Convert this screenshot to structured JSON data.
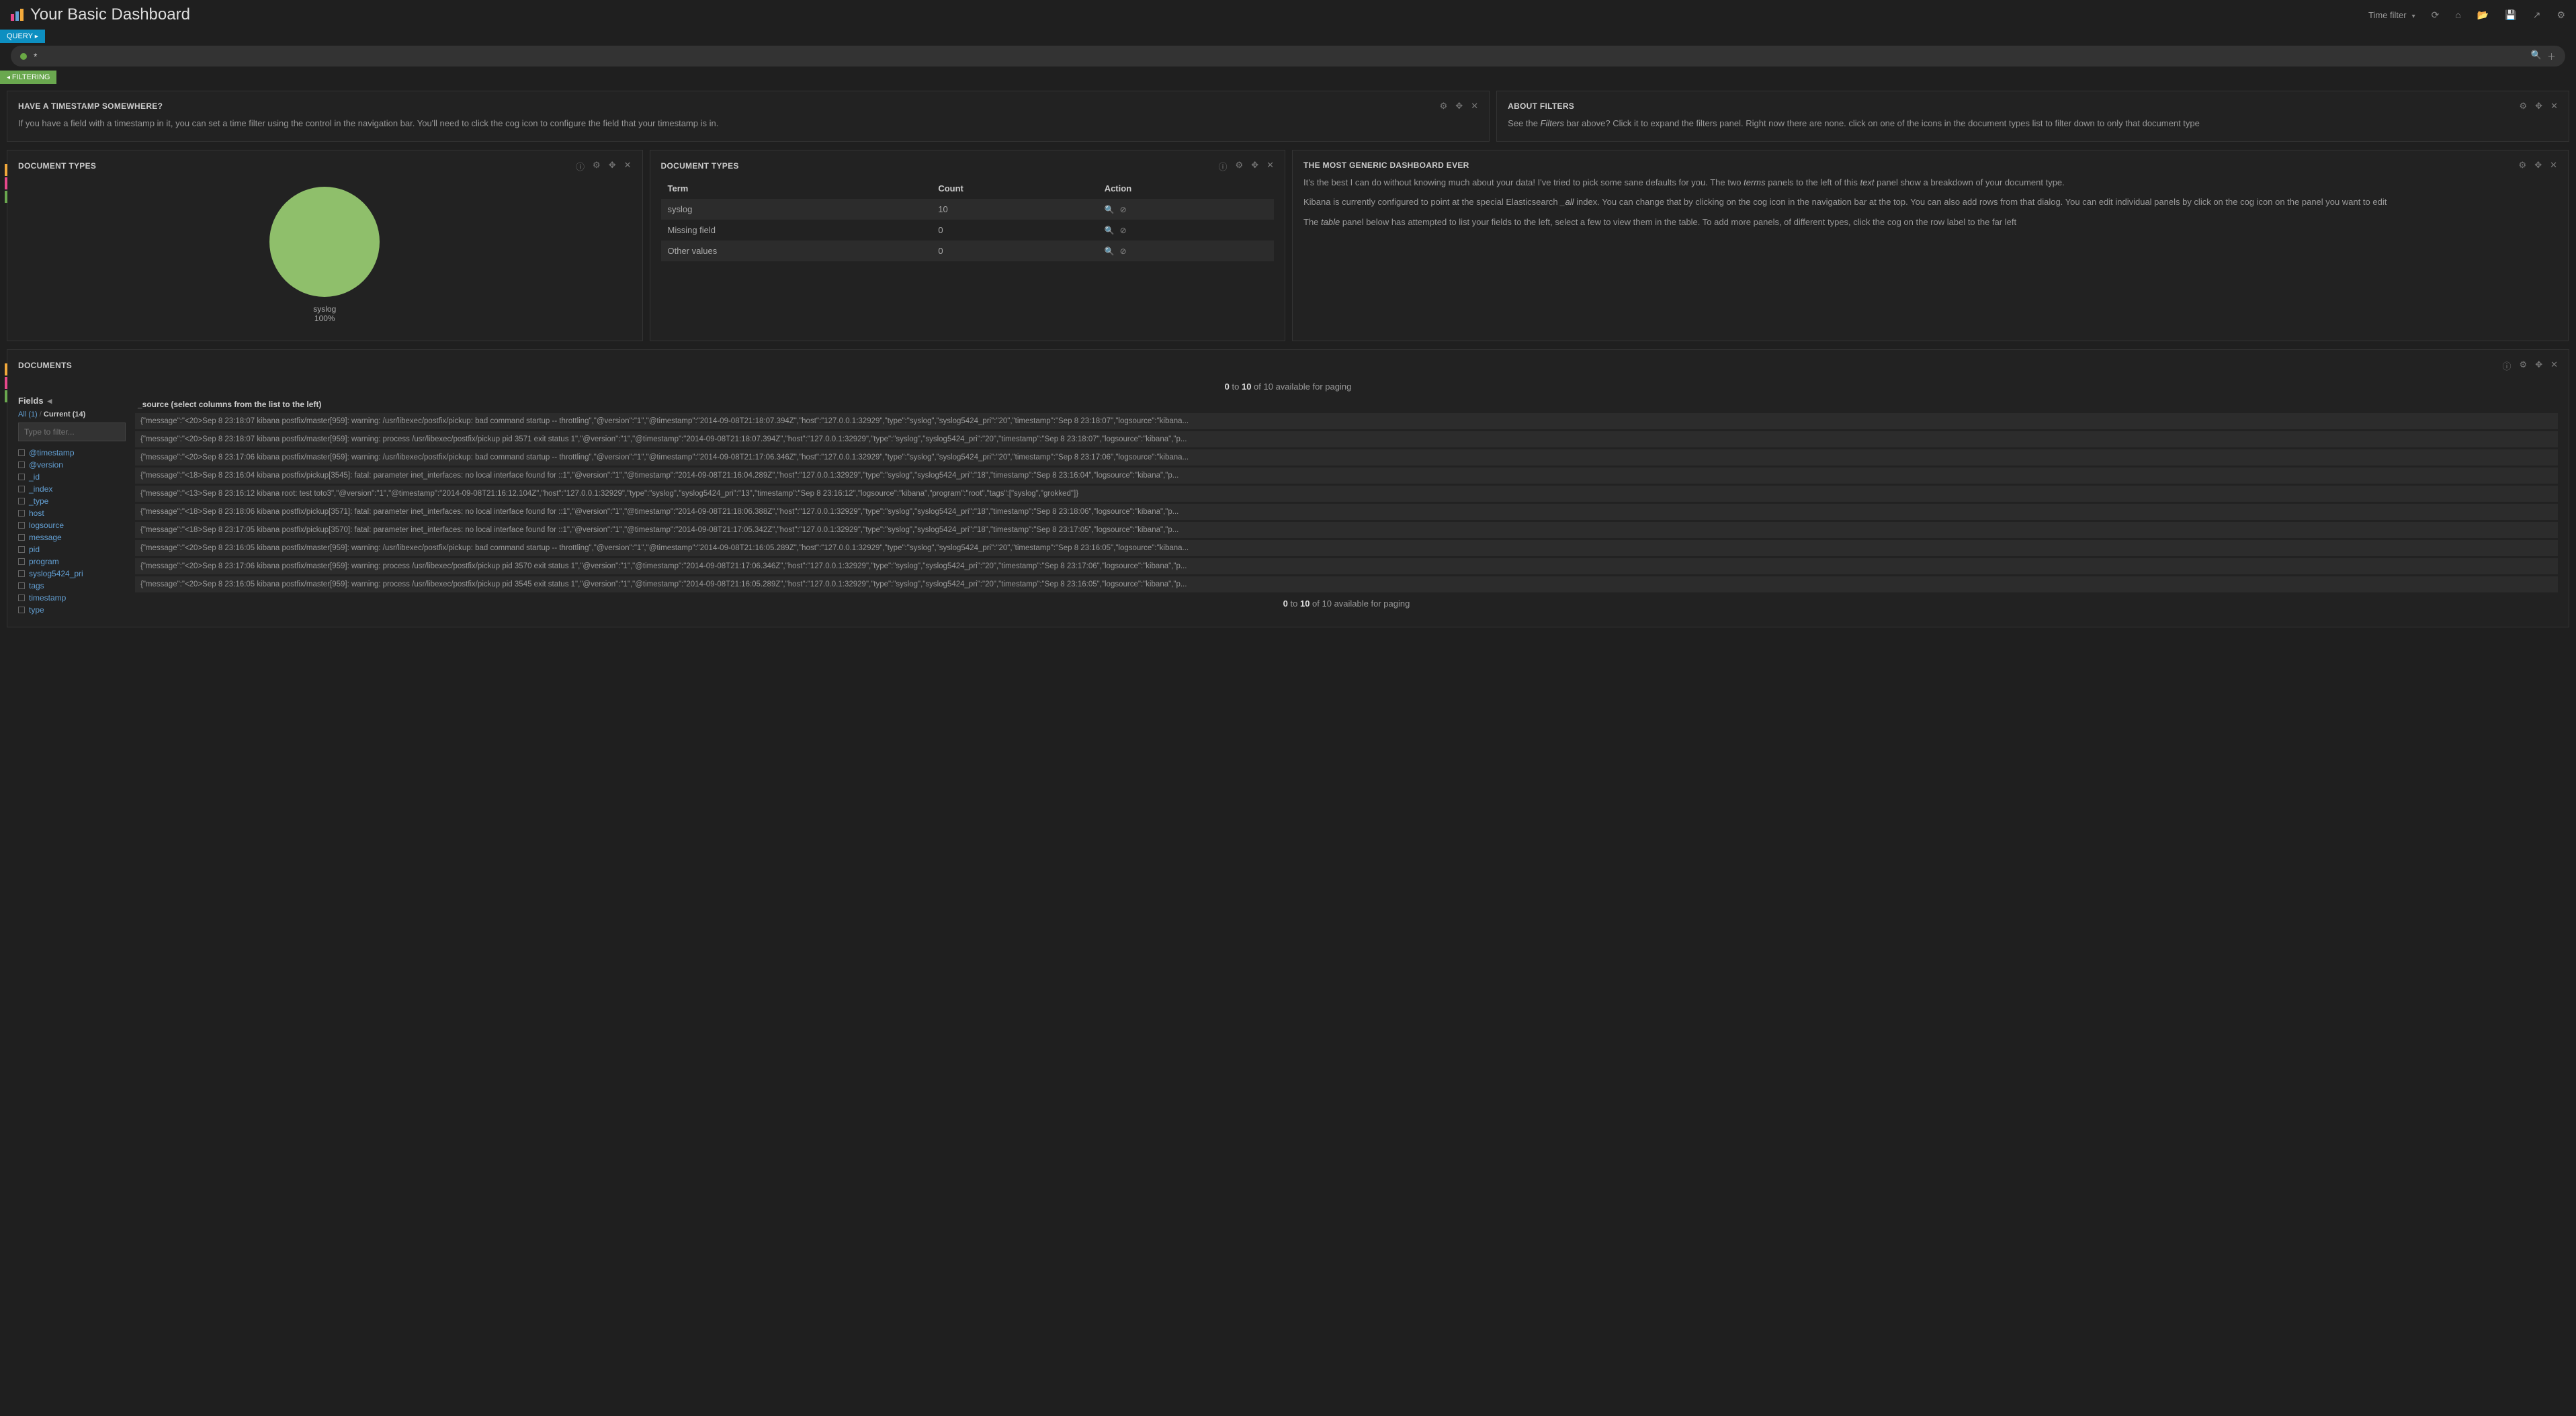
{
  "header": {
    "title": "Your Basic Dashboard",
    "time_filter_label": "Time filter"
  },
  "query": {
    "badge": "QUERY",
    "value": "*"
  },
  "filtering": {
    "badge": "FILTERING"
  },
  "panels": {
    "timestamp_note": {
      "title": "HAVE A TIMESTAMP SOMEWHERE?",
      "body": "If you have a field with a timestamp in it, you can set a time filter using the control in the navigation bar. You'll need to click the cog icon to configure the field that your timestamp is in."
    },
    "about_filters": {
      "title": "ABOUT FILTERS",
      "body_pre": "See the ",
      "body_em": "Filters",
      "body_post": " bar above? Click it to expand the filters panel. Right now there are none. click on one of the icons in the document types list to filter down to only that document type"
    },
    "doc_types_chart": {
      "title": "DOCUMENT TYPES",
      "slice_label": "syslog",
      "slice_pct": "100%"
    },
    "doc_types_table": {
      "title": "DOCUMENT TYPES",
      "cols": {
        "term": "Term",
        "count": "Count",
        "action": "Action"
      },
      "rows": [
        {
          "term": "syslog",
          "count": "10"
        },
        {
          "term": "Missing field",
          "count": "0"
        },
        {
          "term": "Other values",
          "count": "0"
        }
      ]
    },
    "generic": {
      "title": "THE MOST GENERIC DASHBOARD EVER",
      "p1_pre": "It's the best I can do without knowing much about your data! I've tried to pick some sane defaults for you. The two ",
      "p1_em1": "terms",
      "p1_mid": " panels to the left of this ",
      "p1_em2": "text",
      "p1_post": " panel show a breakdown of your document type.",
      "p2_pre": "Kibana is currently configured to point at the special Elasticsearch ",
      "p2_em": "_all",
      "p2_post": " index. You can change that by clicking on the cog icon in the navigation bar at the top. You can also add rows from that dialog. You can edit individual panels by click on the cog icon on the panel you want to edit",
      "p3_pre": "The ",
      "p3_em": "table",
      "p3_post": " panel below has attempted to list your fields to the left, select a few to view them in the table. To add more panels, of different types, click the cog on the row label to the far left"
    },
    "documents": {
      "title": "DOCUMENTS",
      "paging_pre": "0",
      "paging_to": " to ",
      "paging_end": "10",
      "paging_of": " of 10 available for paging",
      "fields_head": "Fields",
      "all_link": "All (1)",
      "current_link": "Current (14)",
      "filter_placeholder": "Type to filter...",
      "source_head": "_source (select columns from the list to the left)",
      "field_list": [
        "@timestamp",
        "@version",
        "_id",
        "_index",
        "_type",
        "host",
        "logsource",
        "message",
        "pid",
        "program",
        "syslog5424_pri",
        "tags",
        "timestamp",
        "type"
      ],
      "rows": [
        "{\"message\":\"<20>Sep 8 23:18:07 kibana postfix/master[959]: warning: /usr/libexec/postfix/pickup: bad command startup -- throttling\",\"@version\":\"1\",\"@timestamp\":\"2014-09-08T21:18:07.394Z\",\"host\":\"127.0.0.1:32929\",\"type\":\"syslog\",\"syslog5424_pri\":\"20\",\"timestamp\":\"Sep 8 23:18:07\",\"logsource\":\"kibana...",
        "{\"message\":\"<20>Sep 8 23:18:07 kibana postfix/master[959]: warning: process /usr/libexec/postfix/pickup pid 3571 exit status 1\",\"@version\":\"1\",\"@timestamp\":\"2014-09-08T21:18:07.394Z\",\"host\":\"127.0.0.1:32929\",\"type\":\"syslog\",\"syslog5424_pri\":\"20\",\"timestamp\":\"Sep 8 23:18:07\",\"logsource\":\"kibana\",\"p...",
        "{\"message\":\"<20>Sep 8 23:17:06 kibana postfix/master[959]: warning: /usr/libexec/postfix/pickup: bad command startup -- throttling\",\"@version\":\"1\",\"@timestamp\":\"2014-09-08T21:17:06.346Z\",\"host\":\"127.0.0.1:32929\",\"type\":\"syslog\",\"syslog5424_pri\":\"20\",\"timestamp\":\"Sep 8 23:17:06\",\"logsource\":\"kibana...",
        "{\"message\":\"<18>Sep 8 23:16:04 kibana postfix/pickup[3545]: fatal: parameter inet_interfaces: no local interface found for ::1\",\"@version\":\"1\",\"@timestamp\":\"2014-09-08T21:16:04.289Z\",\"host\":\"127.0.0.1:32929\",\"type\":\"syslog\",\"syslog5424_pri\":\"18\",\"timestamp\":\"Sep 8 23:16:04\",\"logsource\":\"kibana\",\"p...",
        "{\"message\":\"<13>Sep 8 23:16:12 kibana root: test toto3\",\"@version\":\"1\",\"@timestamp\":\"2014-09-08T21:16:12.104Z\",\"host\":\"127.0.0.1:32929\",\"type\":\"syslog\",\"syslog5424_pri\":\"13\",\"timestamp\":\"Sep 8 23:16:12\",\"logsource\":\"kibana\",\"program\":\"root\",\"tags\":[\"syslog\",\"grokked\"]}",
        "{\"message\":\"<18>Sep 8 23:18:06 kibana postfix/pickup[3571]: fatal: parameter inet_interfaces: no local interface found for ::1\",\"@version\":\"1\",\"@timestamp\":\"2014-09-08T21:18:06.388Z\",\"host\":\"127.0.0.1:32929\",\"type\":\"syslog\",\"syslog5424_pri\":\"18\",\"timestamp\":\"Sep 8 23:18:06\",\"logsource\":\"kibana\",\"p...",
        "{\"message\":\"<18>Sep 8 23:17:05 kibana postfix/pickup[3570]: fatal: parameter inet_interfaces: no local interface found for ::1\",\"@version\":\"1\",\"@timestamp\":\"2014-09-08T21:17:05.342Z\",\"host\":\"127.0.0.1:32929\",\"type\":\"syslog\",\"syslog5424_pri\":\"18\",\"timestamp\":\"Sep 8 23:17:05\",\"logsource\":\"kibana\",\"p...",
        "{\"message\":\"<20>Sep 8 23:16:05 kibana postfix/master[959]: warning: /usr/libexec/postfix/pickup: bad command startup -- throttling\",\"@version\":\"1\",\"@timestamp\":\"2014-09-08T21:16:05.289Z\",\"host\":\"127.0.0.1:32929\",\"type\":\"syslog\",\"syslog5424_pri\":\"20\",\"timestamp\":\"Sep 8 23:16:05\",\"logsource\":\"kibana...",
        "{\"message\":\"<20>Sep 8 23:17:06 kibana postfix/master[959]: warning: process /usr/libexec/postfix/pickup pid 3570 exit status 1\",\"@version\":\"1\",\"@timestamp\":\"2014-09-08T21:17:06.346Z\",\"host\":\"127.0.0.1:32929\",\"type\":\"syslog\",\"syslog5424_pri\":\"20\",\"timestamp\":\"Sep 8 23:17:06\",\"logsource\":\"kibana\",\"p...",
        "{\"message\":\"<20>Sep 8 23:16:05 kibana postfix/master[959]: warning: process /usr/libexec/postfix/pickup pid 3545 exit status 1\",\"@version\":\"1\",\"@timestamp\":\"2014-09-08T21:16:05.289Z\",\"host\":\"127.0.0.1:32929\",\"type\":\"syslog\",\"syslog5424_pri\":\"20\",\"timestamp\":\"Sep 8 23:16:05\",\"logsource\":\"kibana\",\"p..."
      ]
    }
  },
  "chart_data": {
    "type": "pie",
    "title": "DOCUMENT TYPES",
    "slices": [
      {
        "label": "syslog",
        "value": 10,
        "percent": 100,
        "color": "#8fbf6b"
      }
    ]
  }
}
